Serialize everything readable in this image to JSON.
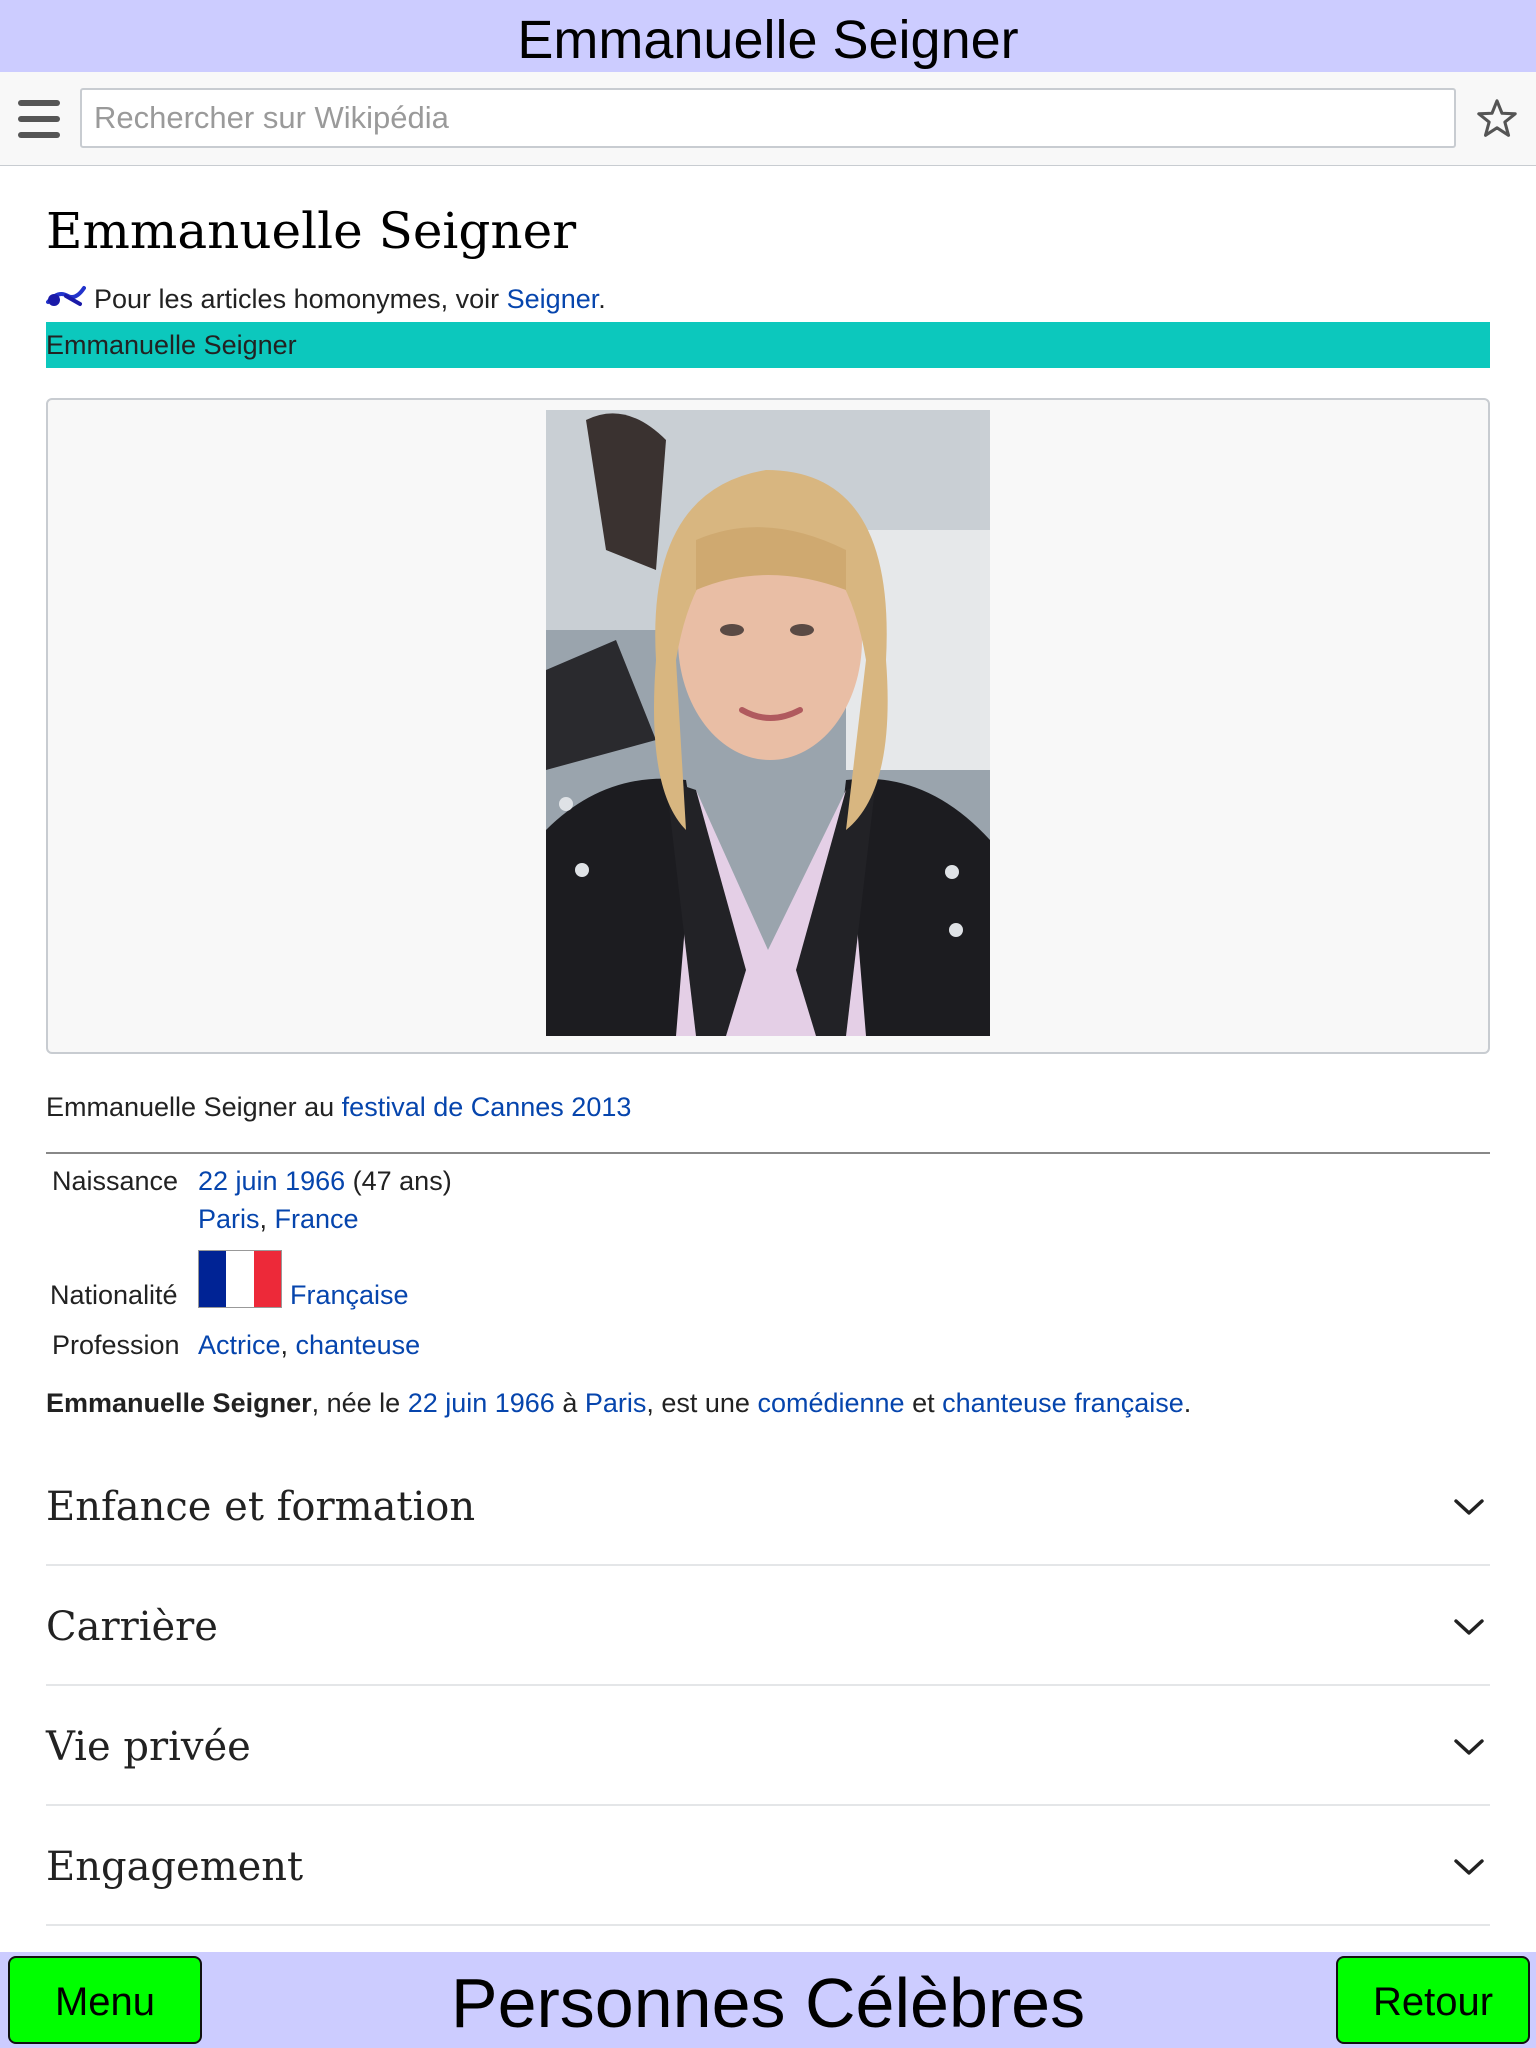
{
  "app": {
    "title": "Emmanuelle Seigner"
  },
  "search": {
    "placeholder": "Rechercher sur Wikipédia"
  },
  "article": {
    "title": "Emmanuelle Seigner",
    "hatnote": {
      "prefix": "Pour les articles homonymes, voir ",
      "link": "Seigner",
      "suffix": "."
    },
    "infobox": {
      "header": "Emmanuelle Seigner",
      "caption_prefix": "Emmanuelle Seigner au ",
      "caption_link": "festival de Cannes 2013",
      "rows": {
        "birth_label": "Naissance",
        "birth_date_link": "22 juin 1966",
        "birth_age": " (47 ans)",
        "birth_city_link": "Paris",
        "birth_sep": ", ",
        "birth_country_link": "France",
        "nationality_label": "Nationalité",
        "nationality_link": "Française",
        "profession_label": "Profession",
        "profession_link1": "Actrice",
        "profession_sep": ", ",
        "profession_link2": "chanteuse"
      },
      "flag_colors": [
        "#002395",
        "#ffffff",
        "#ed2939"
      ]
    },
    "lead": {
      "bold": "Emmanuelle Seigner",
      "t1": ", née le ",
      "l1": "22 juin 1966",
      "t2": " à ",
      "l2": "Paris",
      "t3": ", est une ",
      "l3": "comédienne",
      "t4": " et ",
      "l4": "chanteuse française",
      "t5": "."
    },
    "sections": [
      {
        "title": "Enfance et formation"
      },
      {
        "title": "Carrière"
      },
      {
        "title": "Vie privée"
      },
      {
        "title": "Engagement"
      }
    ]
  },
  "bottom": {
    "title": "Personnes Célèbres",
    "menu_label": "Menu",
    "back_label": "Retour"
  },
  "colors": {
    "header_bg": "#ccccff",
    "infobox_header_bg": "#0cc8bd",
    "link": "#0645ad",
    "button_green": "#00ff00"
  }
}
